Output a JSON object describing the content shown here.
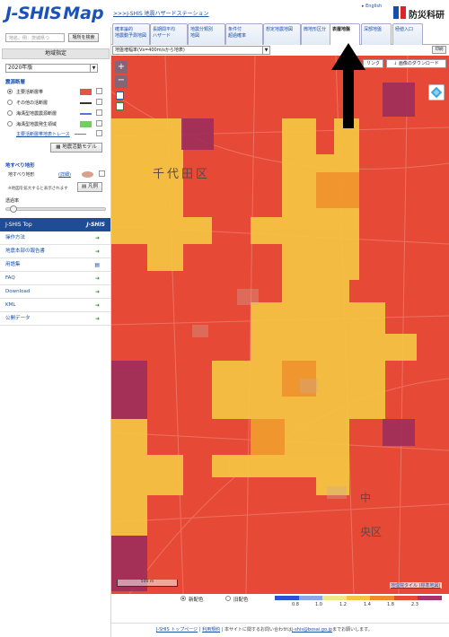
{
  "header": {
    "logo_j": "J-SHIS",
    "logo_map": "Map",
    "site_link": ">>>J-SHIS 地震ハザードステーション",
    "english": "English",
    "nied_mark": "NIED",
    "nied_name": "防災科研"
  },
  "sidebar": {
    "search_placeholder": "地名、例：茨城県つ",
    "search_button": "場所を検索",
    "region_header": "地域指定",
    "year_select": "2020年版",
    "eq_title": "震源断層",
    "eq_items": [
      {
        "label": "主要活断層帯",
        "swatch": "#e8524a"
      },
      {
        "label": "その他の活断層",
        "swatch": "#333333"
      },
      {
        "label": "海溝型地震震源断層",
        "swatch": "#4a7be8"
      },
      {
        "label": "海溝型地震発生領域",
        "swatch": "#6fd05a"
      }
    ],
    "trace_label": "主要活断層帯地表トレース",
    "eq_model_button": "地震活動モデル",
    "landslide_title": "地すべり地形",
    "landslide_label": "地すべり地形",
    "landslide_link": "(詳細)",
    "landslide_note": "※地図を拡大すると表示されます",
    "legend_button": "凡例",
    "opacity_label": "透過率"
  },
  "nav": {
    "top": "J-SHIS Top",
    "brand": "J-SHIS",
    "items": [
      "操作方法",
      "地震本部の報告書",
      "用語集",
      "FAQ",
      "Download",
      "KML",
      "公開データ"
    ]
  },
  "tabs": [
    "確率論的\n地震動予測地図",
    "長期間平均\nハザード",
    "地震分類別\n地図",
    "条件付\n超過確率",
    "想定地震地図",
    "微地形区分",
    "表層地盤",
    "深部地盤",
    "極値入口"
  ],
  "active_tab": "表層地盤",
  "map": {
    "layer_select": "地盤増幅率(Vs=400m/sから地表)",
    "print_button": "印刷",
    "link_button": "リンク",
    "download_button": "画像のダウンロード",
    "district_label": "千代田区",
    "ward_label_1": "中",
    "ward_label_2": "央区",
    "scale_label": "500 m",
    "tile_link": "地理院タイル (標準地図)"
  },
  "legend": {
    "new_color": "新配色",
    "old_color": "旧配色",
    "colors": [
      "#2e4fd8",
      "#8aa8e8",
      "#f2e68a",
      "#f5c542",
      "#f08a2a",
      "#e64a36",
      "#a8326e"
    ],
    "ticks": [
      "0.8",
      "1.0",
      "1.2",
      "1.4",
      "1.8",
      "2.3"
    ]
  },
  "footer": {
    "top_link": "J-SHIS トップページ",
    "terms_link": "利用規約",
    "text": "本サイトに関するお問い合わせは",
    "email": "j-shis@bosai.go.jp",
    "tail": "までお願いします。"
  }
}
